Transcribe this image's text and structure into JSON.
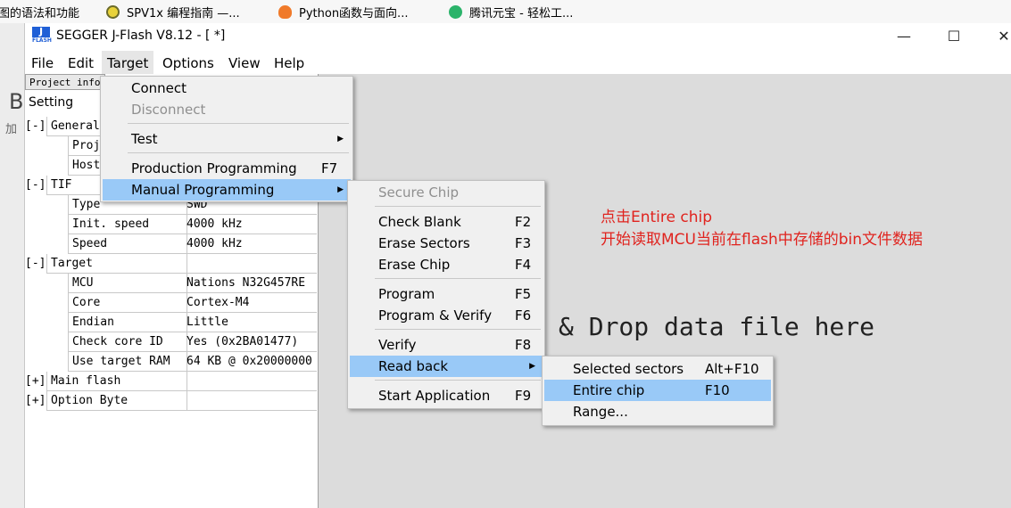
{
  "browser_bookmarks": [
    {
      "label": "图的语法和功能",
      "icon": "none"
    },
    {
      "label": "SPV1x 编程指南 —...",
      "icon": "gear-icon"
    },
    {
      "label": "Python函数与面向...",
      "icon": "fire-icon"
    },
    {
      "label": "腾讯元宝 - 轻松工...",
      "icon": "yuanbao-icon"
    }
  ],
  "background_page": {
    "big_letter": "B",
    "small_text": "加"
  },
  "window": {
    "title": "SEGGER J-Flash V8.12 - [ *]",
    "icon_text": "J",
    "minimize": "—",
    "maximize": "☐",
    "close": "✕"
  },
  "menubar": [
    "File",
    "Edit",
    "Target",
    "Options",
    "View",
    "Help"
  ],
  "panel": {
    "tab": "Project info",
    "heading": "Setting",
    "rows": [
      {
        "toggle": "[-]",
        "key": "General",
        "value": "",
        "indent": 0
      },
      {
        "toggle": "",
        "key": "Proj",
        "value": "",
        "indent": 1
      },
      {
        "toggle": "",
        "key": "Host",
        "value": "",
        "indent": 1
      },
      {
        "toggle": "[-]",
        "key": "TIF",
        "value": "",
        "indent": 0
      },
      {
        "toggle": "",
        "key": "Type",
        "value": "SWD",
        "indent": 1
      },
      {
        "toggle": "",
        "key": "Init. speed",
        "value": "4000 kHz",
        "indent": 1
      },
      {
        "toggle": "",
        "key": "Speed",
        "value": "4000 kHz",
        "indent": 1
      },
      {
        "toggle": "[-]",
        "key": "Target",
        "value": "",
        "indent": 0
      },
      {
        "toggle": "",
        "key": "MCU",
        "value": "Nations N32G457RE",
        "indent": 1
      },
      {
        "toggle": "",
        "key": "Core",
        "value": "Cortex-M4",
        "indent": 1
      },
      {
        "toggle": "",
        "key": "Endian",
        "value": "Little",
        "indent": 1
      },
      {
        "toggle": "",
        "key": "Check core ID",
        "value": "Yes (0x2BA01477)",
        "indent": 1
      },
      {
        "toggle": "",
        "key": "Use target RAM",
        "value": "64 KB @ 0x20000000",
        "indent": 1
      },
      {
        "toggle": "[+]",
        "key": "Main flash",
        "value": "",
        "indent": 0
      },
      {
        "toggle": "[+]",
        "key": "Option Byte",
        "value": "",
        "indent": 0
      }
    ]
  },
  "drop_hint": "& Drop data file here",
  "target_menu": {
    "connect": "Connect",
    "disconnect": "Disconnect",
    "test": "Test",
    "production": "Production Programming",
    "production_sc": "F7",
    "manual": "Manual Programming"
  },
  "manual_menu": {
    "secure": "Secure Chip",
    "check_blank": "Check Blank",
    "check_blank_sc": "F2",
    "erase_sectors": "Erase Sectors",
    "erase_sectors_sc": "F3",
    "erase_chip": "Erase Chip",
    "erase_chip_sc": "F4",
    "program": "Program",
    "program_sc": "F5",
    "program_verify": "Program & Verify",
    "program_verify_sc": "F6",
    "verify": "Verify",
    "verify_sc": "F8",
    "read_back": "Read back",
    "start_app": "Start Application",
    "start_app_sc": "F9"
  },
  "readback_menu": {
    "selected": "Selected sectors",
    "selected_sc": "Alt+F10",
    "entire": "Entire chip",
    "entire_sc": "F10",
    "range": "Range..."
  },
  "annotation": {
    "line1": "点击Entire chip",
    "line2": "开始读取MCU当前在flash中存储的bin文件数据"
  },
  "colors": {
    "highlight": "#99c9f7",
    "annotation": "#e0231e",
    "disabled": "#8f8f8f"
  }
}
